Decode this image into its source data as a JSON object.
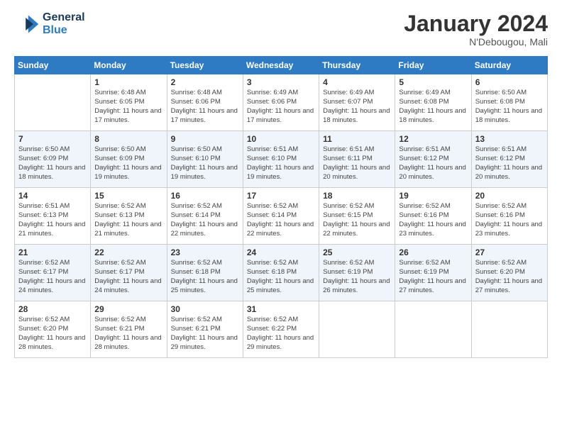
{
  "header": {
    "logo_line1": "General",
    "logo_line2": "Blue",
    "month": "January 2024",
    "location": "N'Debougou, Mali"
  },
  "weekdays": [
    "Sunday",
    "Monday",
    "Tuesday",
    "Wednesday",
    "Thursday",
    "Friday",
    "Saturday"
  ],
  "weeks": [
    [
      {
        "day": "",
        "sunrise": "",
        "sunset": "",
        "daylight": ""
      },
      {
        "day": "1",
        "sunrise": "Sunrise: 6:48 AM",
        "sunset": "Sunset: 6:05 PM",
        "daylight": "Daylight: 11 hours and 17 minutes."
      },
      {
        "day": "2",
        "sunrise": "Sunrise: 6:48 AM",
        "sunset": "Sunset: 6:06 PM",
        "daylight": "Daylight: 11 hours and 17 minutes."
      },
      {
        "day": "3",
        "sunrise": "Sunrise: 6:49 AM",
        "sunset": "Sunset: 6:06 PM",
        "daylight": "Daylight: 11 hours and 17 minutes."
      },
      {
        "day": "4",
        "sunrise": "Sunrise: 6:49 AM",
        "sunset": "Sunset: 6:07 PM",
        "daylight": "Daylight: 11 hours and 18 minutes."
      },
      {
        "day": "5",
        "sunrise": "Sunrise: 6:49 AM",
        "sunset": "Sunset: 6:08 PM",
        "daylight": "Daylight: 11 hours and 18 minutes."
      },
      {
        "day": "6",
        "sunrise": "Sunrise: 6:50 AM",
        "sunset": "Sunset: 6:08 PM",
        "daylight": "Daylight: 11 hours and 18 minutes."
      }
    ],
    [
      {
        "day": "7",
        "sunrise": "Sunrise: 6:50 AM",
        "sunset": "Sunset: 6:09 PM",
        "daylight": "Daylight: 11 hours and 18 minutes."
      },
      {
        "day": "8",
        "sunrise": "Sunrise: 6:50 AM",
        "sunset": "Sunset: 6:09 PM",
        "daylight": "Daylight: 11 hours and 19 minutes."
      },
      {
        "day": "9",
        "sunrise": "Sunrise: 6:50 AM",
        "sunset": "Sunset: 6:10 PM",
        "daylight": "Daylight: 11 hours and 19 minutes."
      },
      {
        "day": "10",
        "sunrise": "Sunrise: 6:51 AM",
        "sunset": "Sunset: 6:10 PM",
        "daylight": "Daylight: 11 hours and 19 minutes."
      },
      {
        "day": "11",
        "sunrise": "Sunrise: 6:51 AM",
        "sunset": "Sunset: 6:11 PM",
        "daylight": "Daylight: 11 hours and 20 minutes."
      },
      {
        "day": "12",
        "sunrise": "Sunrise: 6:51 AM",
        "sunset": "Sunset: 6:12 PM",
        "daylight": "Daylight: 11 hours and 20 minutes."
      },
      {
        "day": "13",
        "sunrise": "Sunrise: 6:51 AM",
        "sunset": "Sunset: 6:12 PM",
        "daylight": "Daylight: 11 hours and 20 minutes."
      }
    ],
    [
      {
        "day": "14",
        "sunrise": "Sunrise: 6:51 AM",
        "sunset": "Sunset: 6:13 PM",
        "daylight": "Daylight: 11 hours and 21 minutes."
      },
      {
        "day": "15",
        "sunrise": "Sunrise: 6:52 AM",
        "sunset": "Sunset: 6:13 PM",
        "daylight": "Daylight: 11 hours and 21 minutes."
      },
      {
        "day": "16",
        "sunrise": "Sunrise: 6:52 AM",
        "sunset": "Sunset: 6:14 PM",
        "daylight": "Daylight: 11 hours and 22 minutes."
      },
      {
        "day": "17",
        "sunrise": "Sunrise: 6:52 AM",
        "sunset": "Sunset: 6:14 PM",
        "daylight": "Daylight: 11 hours and 22 minutes."
      },
      {
        "day": "18",
        "sunrise": "Sunrise: 6:52 AM",
        "sunset": "Sunset: 6:15 PM",
        "daylight": "Daylight: 11 hours and 22 minutes."
      },
      {
        "day": "19",
        "sunrise": "Sunrise: 6:52 AM",
        "sunset": "Sunset: 6:16 PM",
        "daylight": "Daylight: 11 hours and 23 minutes."
      },
      {
        "day": "20",
        "sunrise": "Sunrise: 6:52 AM",
        "sunset": "Sunset: 6:16 PM",
        "daylight": "Daylight: 11 hours and 23 minutes."
      }
    ],
    [
      {
        "day": "21",
        "sunrise": "Sunrise: 6:52 AM",
        "sunset": "Sunset: 6:17 PM",
        "daylight": "Daylight: 11 hours and 24 minutes."
      },
      {
        "day": "22",
        "sunrise": "Sunrise: 6:52 AM",
        "sunset": "Sunset: 6:17 PM",
        "daylight": "Daylight: 11 hours and 24 minutes."
      },
      {
        "day": "23",
        "sunrise": "Sunrise: 6:52 AM",
        "sunset": "Sunset: 6:18 PM",
        "daylight": "Daylight: 11 hours and 25 minutes."
      },
      {
        "day": "24",
        "sunrise": "Sunrise: 6:52 AM",
        "sunset": "Sunset: 6:18 PM",
        "daylight": "Daylight: 11 hours and 25 minutes."
      },
      {
        "day": "25",
        "sunrise": "Sunrise: 6:52 AM",
        "sunset": "Sunset: 6:19 PM",
        "daylight": "Daylight: 11 hours and 26 minutes."
      },
      {
        "day": "26",
        "sunrise": "Sunrise: 6:52 AM",
        "sunset": "Sunset: 6:19 PM",
        "daylight": "Daylight: 11 hours and 27 minutes."
      },
      {
        "day": "27",
        "sunrise": "Sunrise: 6:52 AM",
        "sunset": "Sunset: 6:20 PM",
        "daylight": "Daylight: 11 hours and 27 minutes."
      }
    ],
    [
      {
        "day": "28",
        "sunrise": "Sunrise: 6:52 AM",
        "sunset": "Sunset: 6:20 PM",
        "daylight": "Daylight: 11 hours and 28 minutes."
      },
      {
        "day": "29",
        "sunrise": "Sunrise: 6:52 AM",
        "sunset": "Sunset: 6:21 PM",
        "daylight": "Daylight: 11 hours and 28 minutes."
      },
      {
        "day": "30",
        "sunrise": "Sunrise: 6:52 AM",
        "sunset": "Sunset: 6:21 PM",
        "daylight": "Daylight: 11 hours and 29 minutes."
      },
      {
        "day": "31",
        "sunrise": "Sunrise: 6:52 AM",
        "sunset": "Sunset: 6:22 PM",
        "daylight": "Daylight: 11 hours and 29 minutes."
      },
      {
        "day": "",
        "sunrise": "",
        "sunset": "",
        "daylight": ""
      },
      {
        "day": "",
        "sunrise": "",
        "sunset": "",
        "daylight": ""
      },
      {
        "day": "",
        "sunrise": "",
        "sunset": "",
        "daylight": ""
      }
    ]
  ]
}
